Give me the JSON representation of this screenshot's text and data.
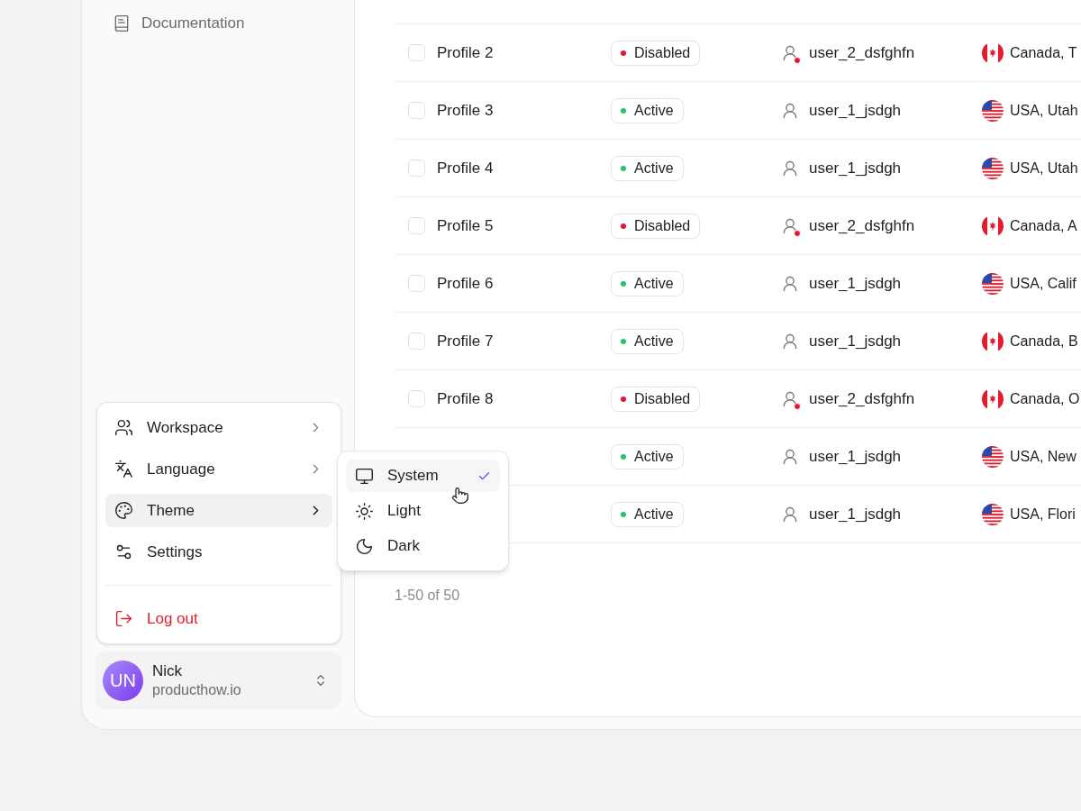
{
  "sidebar": {
    "items": [
      {
        "label": "Documentation"
      }
    ]
  },
  "account_menu": {
    "items": [
      {
        "label": "Workspace",
        "kind": "submenu",
        "selected": false
      },
      {
        "label": "Language",
        "kind": "submenu",
        "selected": false
      },
      {
        "label": "Theme",
        "kind": "submenu",
        "selected": true
      },
      {
        "label": "Settings",
        "kind": "plain",
        "selected": false
      },
      {
        "label": "Log out",
        "kind": "danger",
        "selected": false
      }
    ]
  },
  "theme_menu": {
    "items": [
      {
        "label": "System",
        "selected": true
      },
      {
        "label": "Light",
        "selected": false
      },
      {
        "label": "Dark",
        "selected": false
      }
    ]
  },
  "user": {
    "initials": "UN",
    "name": "Nick",
    "subtitle": "producthow.io"
  },
  "table": {
    "rows": [
      {
        "checked": false,
        "name": "Profile 2",
        "status": "Disabled",
        "color": "#e5162b",
        "username": "user_2_dsfghfn",
        "flag": {
          "kind": "canada"
        },
        "location": "Canada, T"
      },
      {
        "checked": false,
        "name": "Profile 3",
        "status": "Active",
        "color": "#22c55e",
        "username": "user_1_jsdgh",
        "flag": {
          "kind": "usa"
        },
        "location": "USA, Utah"
      },
      {
        "checked": false,
        "name": "Profile 4",
        "status": "Active",
        "color": "#22c55e",
        "username": "user_1_jsdgh",
        "flag": {
          "kind": "usa"
        },
        "location": "USA, Utah"
      },
      {
        "checked": false,
        "name": "Profile 5",
        "status": "Disabled",
        "color": "#e5162b",
        "username": "user_2_dsfghfn",
        "flag": {
          "kind": "canada"
        },
        "location": "Canada, A"
      },
      {
        "checked": false,
        "name": "Profile 6",
        "status": "Active",
        "color": "#22c55e",
        "username": "user_1_jsdgh",
        "flag": {
          "kind": "usa"
        },
        "location": "USA, Calif"
      },
      {
        "checked": false,
        "name": "Profile 7",
        "status": "Active",
        "color": "#22c55e",
        "username": "user_1_jsdgh",
        "flag": {
          "kind": "canada"
        },
        "location": "Canada, B"
      },
      {
        "checked": false,
        "name": "Profile 8",
        "status": "Disabled",
        "color": "#e5162b",
        "username": "user_2_dsfghfn",
        "flag": {
          "kind": "canada"
        },
        "location": "Canada, O"
      },
      {
        "status": "Active",
        "color": "#22c55e",
        "username": "user_1_jsdgh",
        "flag": {
          "kind": "usa"
        },
        "location": "USA, New"
      },
      {
        "status": "Active",
        "color": "#22c55e",
        "username": "user_1_jsdgh",
        "flag": {
          "kind": "usa"
        },
        "location": "USA, Flori"
      }
    ]
  },
  "pagination": {
    "summary": "1-50 of 50"
  }
}
